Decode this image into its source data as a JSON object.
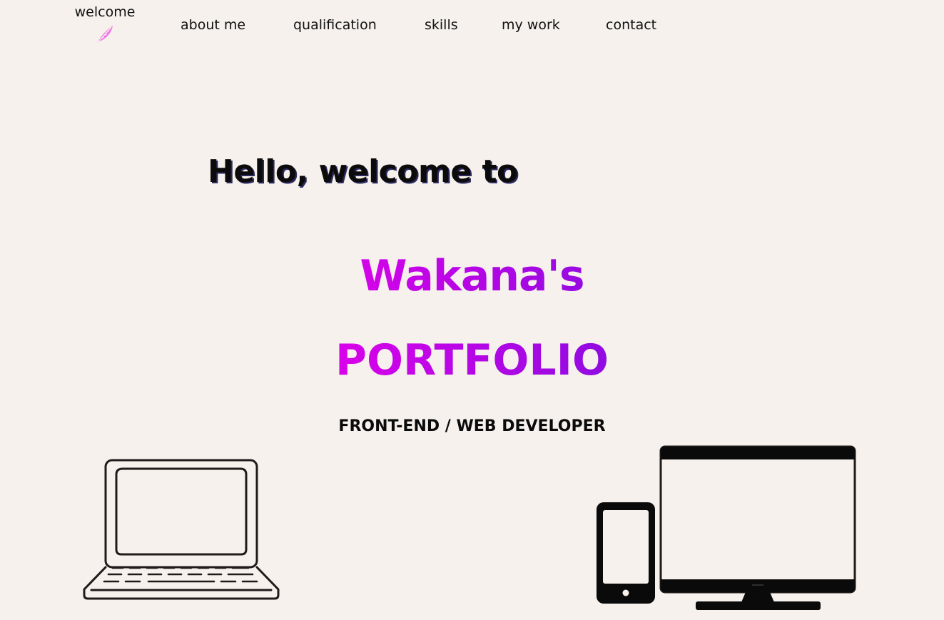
{
  "nav": {
    "brand": {
      "label": "welcome",
      "icon": "feather-icon"
    },
    "links": [
      {
        "label": "about me"
      },
      {
        "label": "qualification"
      },
      {
        "label": "skills"
      },
      {
        "label": "my work"
      },
      {
        "label": "contact"
      }
    ]
  },
  "hero": {
    "greeting": "Hello, welcome to",
    "name": "Wakana's",
    "title": "PORTFOLIO",
    "subtitle": "FRONT-END / WEB DEVELOPER"
  },
  "illustrations": {
    "left": "laptop-icon",
    "right": "phone-and-monitor-icon"
  },
  "colors": {
    "background": "#f6f1ec",
    "gradient_start": "#ff00e6",
    "gradient_end": "#4b14d8",
    "feather": "#f07ae6",
    "text": "#111111"
  }
}
